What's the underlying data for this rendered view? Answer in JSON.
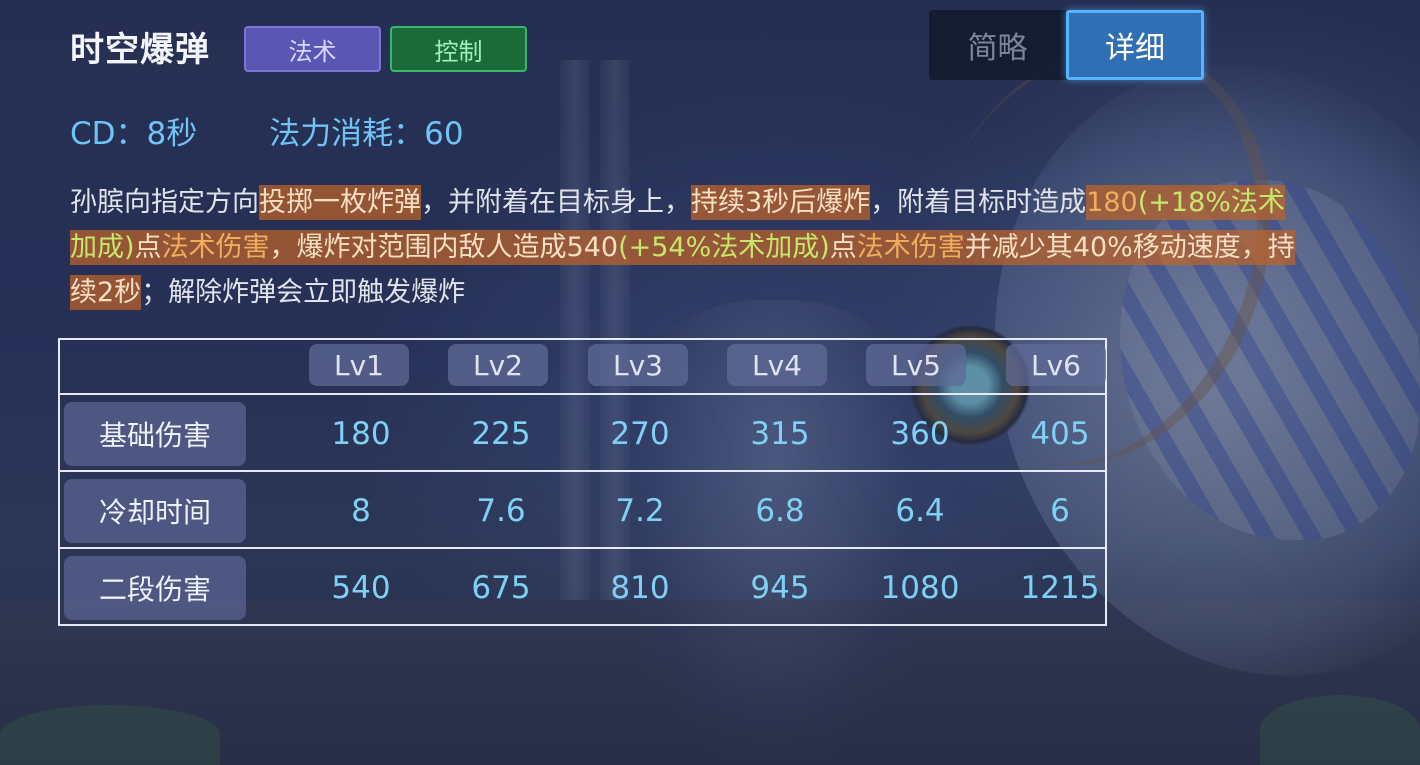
{
  "skill": {
    "name": "时空爆弹",
    "tags": [
      "法术",
      "控制"
    ],
    "colors": {
      "tag_magic": "#5a56b3",
      "tag_control": "#1c6a3a",
      "accent_blue": "#6fc3f5",
      "highlight": "#be6428"
    }
  },
  "view_toggle": {
    "brief_label": "简略",
    "detail_label": "详细",
    "selected": "详细"
  },
  "stats": {
    "cd": "CD：8秒",
    "mana_cost": "法力消耗：60"
  },
  "description": {
    "segments": [
      "孙膑向指定方向",
      "投掷一枚炸弹",
      "，并附着在目标身上，",
      "持续3秒后爆炸",
      "，附着目标时造成",
      "180",
      "(+18%法术加成)",
      "点",
      "法术伤害",
      "，",
      "爆炸对范围内敌人造成540",
      "(+54%法术加成)",
      "点",
      "法术伤害",
      "并",
      "减少其40%移动速度，持续2秒",
      "；解除炸弹会立即触发爆炸"
    ]
  },
  "table": {
    "levels": [
      "Lv1",
      "Lv2",
      "Lv3",
      "Lv4",
      "Lv5",
      "Lv6"
    ],
    "rows": [
      {
        "label": "基础伤害",
        "values": [
          "180",
          "225",
          "270",
          "315",
          "360",
          "405"
        ]
      },
      {
        "label": "冷却时间",
        "values": [
          "8",
          "7.6",
          "7.2",
          "6.8",
          "6.4",
          "6"
        ]
      },
      {
        "label": "二段伤害",
        "values": [
          "540",
          "675",
          "810",
          "945",
          "1080",
          "1215"
        ]
      }
    ]
  }
}
